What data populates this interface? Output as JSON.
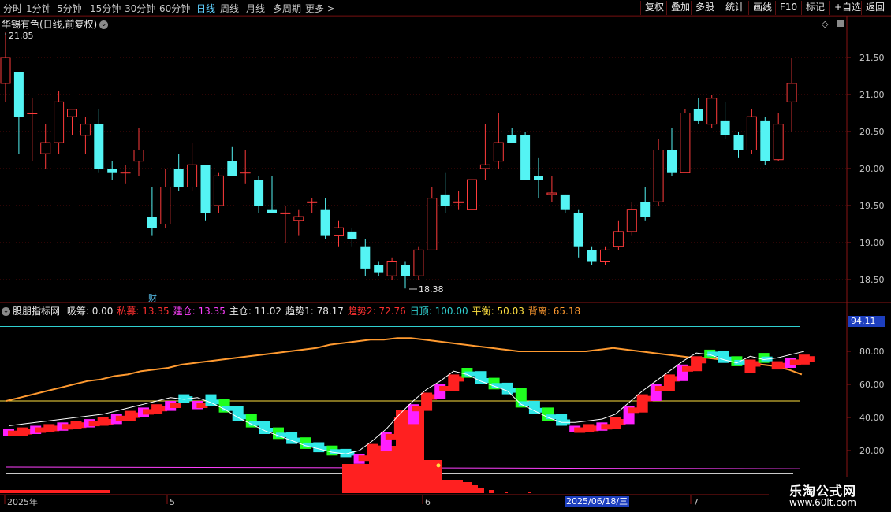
{
  "toolbar": {
    "periods": [
      "分时",
      "1分钟",
      "5分钟",
      "15分钟",
      "30分钟",
      "60分钟",
      "日线",
      "周线",
      "月线",
      "多周期",
      "更多 >"
    ],
    "active": "日线",
    "right": [
      "复权",
      "叠加",
      "多股",
      "统计",
      "画线",
      "F10",
      "标记",
      "+自选",
      "返回"
    ]
  },
  "main": {
    "title": "华锡有色(日线,前复权)",
    "high_label": "21.85",
    "low_label": "18.38",
    "cai_label": "财",
    "y_axis": [
      "21.50",
      "21.00",
      "20.50",
      "20.00",
      "19.50",
      "19.00",
      "18.50"
    ],
    "candles": [
      {
        "o": 21.15,
        "h": 21.85,
        "l": 20.9,
        "c": 21.5
      },
      {
        "o": 21.3,
        "h": 21.3,
        "l": 20.2,
        "c": 20.7
      },
      {
        "o": 20.75,
        "h": 20.95,
        "l": 20.1,
        "c": 20.75
      },
      {
        "o": 20.2,
        "h": 20.6,
        "l": 20.0,
        "c": 20.35
      },
      {
        "o": 20.35,
        "h": 21.05,
        "l": 20.2,
        "c": 20.9
      },
      {
        "o": 20.7,
        "h": 20.8,
        "l": 20.45,
        "c": 20.8
      },
      {
        "o": 20.45,
        "h": 20.7,
        "l": 20.2,
        "c": 20.6
      },
      {
        "o": 20.6,
        "h": 20.8,
        "l": 19.95,
        "c": 20.0
      },
      {
        "o": 20.0,
        "h": 20.1,
        "l": 19.85,
        "c": 19.95
      },
      {
        "o": 19.95,
        "h": 20.05,
        "l": 19.8,
        "c": 19.95
      },
      {
        "o": 20.1,
        "h": 20.55,
        "l": 19.9,
        "c": 20.25
      },
      {
        "o": 19.35,
        "h": 19.75,
        "l": 19.1,
        "c": 19.2
      },
      {
        "o": 19.25,
        "h": 20.0,
        "l": 19.2,
        "c": 19.75
      },
      {
        "o": 20.0,
        "h": 20.2,
        "l": 19.7,
        "c": 19.75
      },
      {
        "o": 19.75,
        "h": 20.35,
        "l": 19.7,
        "c": 20.05
      },
      {
        "o": 20.05,
        "h": 20.05,
        "l": 19.3,
        "c": 19.4
      },
      {
        "o": 19.5,
        "h": 19.95,
        "l": 19.4,
        "c": 19.9
      },
      {
        "o": 20.1,
        "h": 20.3,
        "l": 19.9,
        "c": 19.9
      },
      {
        "o": 19.95,
        "h": 20.25,
        "l": 19.8,
        "c": 19.95
      },
      {
        "o": 19.85,
        "h": 19.9,
        "l": 19.4,
        "c": 19.5
      },
      {
        "o": 19.45,
        "h": 19.9,
        "l": 19.4,
        "c": 19.4
      },
      {
        "o": 19.4,
        "h": 19.5,
        "l": 19.0,
        "c": 19.4
      },
      {
        "o": 19.3,
        "h": 19.45,
        "l": 19.1,
        "c": 19.35
      },
      {
        "o": 19.55,
        "h": 19.6,
        "l": 19.4,
        "c": 19.55
      },
      {
        "o": 19.45,
        "h": 19.6,
        "l": 19.05,
        "c": 19.1
      },
      {
        "o": 19.1,
        "h": 19.3,
        "l": 18.95,
        "c": 19.2
      },
      {
        "o": 19.15,
        "h": 19.2,
        "l": 18.95,
        "c": 19.05
      },
      {
        "o": 18.95,
        "h": 19.05,
        "l": 18.55,
        "c": 18.65
      },
      {
        "o": 18.7,
        "h": 18.75,
        "l": 18.55,
        "c": 18.6
      },
      {
        "o": 18.55,
        "h": 18.8,
        "l": 18.5,
        "c": 18.75
      },
      {
        "o": 18.7,
        "h": 18.75,
        "l": 18.38,
        "c": 18.55
      },
      {
        "o": 18.55,
        "h": 18.95,
        "l": 18.5,
        "c": 18.9
      },
      {
        "o": 18.9,
        "h": 19.75,
        "l": 18.9,
        "c": 19.6
      },
      {
        "o": 19.65,
        "h": 19.95,
        "l": 19.4,
        "c": 19.5
      },
      {
        "o": 19.55,
        "h": 19.7,
        "l": 19.45,
        "c": 19.55
      },
      {
        "o": 19.45,
        "h": 19.9,
        "l": 19.4,
        "c": 19.85
      },
      {
        "o": 20.0,
        "h": 20.6,
        "l": 19.85,
        "c": 20.05
      },
      {
        "o": 20.1,
        "h": 20.75,
        "l": 20.0,
        "c": 20.35
      },
      {
        "o": 20.45,
        "h": 20.55,
        "l": 20.4,
        "c": 20.35
      },
      {
        "o": 20.45,
        "h": 20.5,
        "l": 19.85,
        "c": 19.85
      },
      {
        "o": 19.9,
        "h": 20.15,
        "l": 19.6,
        "c": 19.85
      },
      {
        "o": 19.65,
        "h": 19.9,
        "l": 19.55,
        "c": 19.67
      },
      {
        "o": 19.65,
        "h": 19.65,
        "l": 19.4,
        "c": 19.45
      },
      {
        "o": 19.4,
        "h": 19.45,
        "l": 18.8,
        "c": 18.95
      },
      {
        "o": 18.9,
        "h": 18.95,
        "l": 18.7,
        "c": 18.75
      },
      {
        "o": 18.75,
        "h": 18.95,
        "l": 18.7,
        "c": 18.9
      },
      {
        "o": 18.95,
        "h": 19.3,
        "l": 18.9,
        "c": 19.15
      },
      {
        "o": 19.15,
        "h": 19.55,
        "l": 19.1,
        "c": 19.45
      },
      {
        "o": 19.55,
        "h": 19.75,
        "l": 19.3,
        "c": 19.35
      },
      {
        "o": 19.55,
        "h": 20.4,
        "l": 19.5,
        "c": 20.25
      },
      {
        "o": 20.25,
        "h": 20.55,
        "l": 19.9,
        "c": 19.95
      },
      {
        "o": 19.95,
        "h": 20.8,
        "l": 19.95,
        "c": 20.75
      },
      {
        "o": 20.8,
        "h": 20.95,
        "l": 20.6,
        "c": 20.65
      },
      {
        "o": 20.6,
        "h": 21.0,
        "l": 20.55,
        "c": 20.95
      },
      {
        "o": 20.65,
        "h": 20.9,
        "l": 20.4,
        "c": 20.45
      },
      {
        "o": 20.45,
        "h": 20.5,
        "l": 20.15,
        "c": 20.25
      },
      {
        "o": 20.25,
        "h": 20.8,
        "l": 20.2,
        "c": 20.7
      },
      {
        "o": 20.65,
        "h": 20.7,
        "l": 20.05,
        "c": 20.1
      },
      {
        "o": 20.12,
        "h": 20.75,
        "l": 20.1,
        "c": 20.6
      },
      {
        "o": 20.9,
        "h": 21.5,
        "l": 20.5,
        "c": 21.15
      }
    ]
  },
  "indicator": {
    "name": "股朋指标网",
    "fields": [
      {
        "label": "吸筹: 0.00",
        "color": "#e6e6e6"
      },
      {
        "label": "私募: 13.35",
        "color": "#ff3030"
      },
      {
        "label": "建仓: 13.35",
        "color": "#ff40ff"
      },
      {
        "label": "主仓: 11.02",
        "color": "#e6e6e6"
      },
      {
        "label": "趋势1: 78.17",
        "color": "#e6e6e6"
      },
      {
        "label": "趋势2: 72.76",
        "color": "#ff3030"
      },
      {
        "label": "日顶: 100.00",
        "color": "#30d0d0"
      },
      {
        "label": "平衡: 50.03",
        "color": "#ffe040"
      },
      {
        "label": "背离: 65.18",
        "color": "#ff9a30"
      }
    ],
    "y_axis": [
      "80.00",
      "60.00",
      "40.00",
      "20.00"
    ],
    "price_tag": "94.11",
    "trend1": [
      33,
      34,
      35,
      36,
      37,
      38,
      39,
      40,
      42,
      44,
      46,
      48,
      50,
      49,
      50,
      47,
      43,
      38,
      34,
      30,
      27,
      24,
      21,
      19,
      17,
      16,
      18,
      24,
      31,
      40,
      48,
      55,
      60,
      66,
      64,
      60,
      57,
      54,
      46,
      42,
      38,
      35,
      35,
      36,
      37,
      40,
      47,
      54,
      60,
      66,
      72,
      77,
      76,
      73,
      71,
      75,
      73,
      74,
      76,
      78
    ]
  },
  "xaxis": {
    "labels": [
      "2025年",
      "5",
      "6",
      "7"
    ],
    "date_tag": "2025/06/18/三"
  },
  "watermark": {
    "line1": "乐淘公式网",
    "line2": "www.60lt.com"
  },
  "colors": {
    "up": "#ff3b3b",
    "down": "#54f4f4",
    "bg": "#000000",
    "grid": "#5a0a0a"
  }
}
